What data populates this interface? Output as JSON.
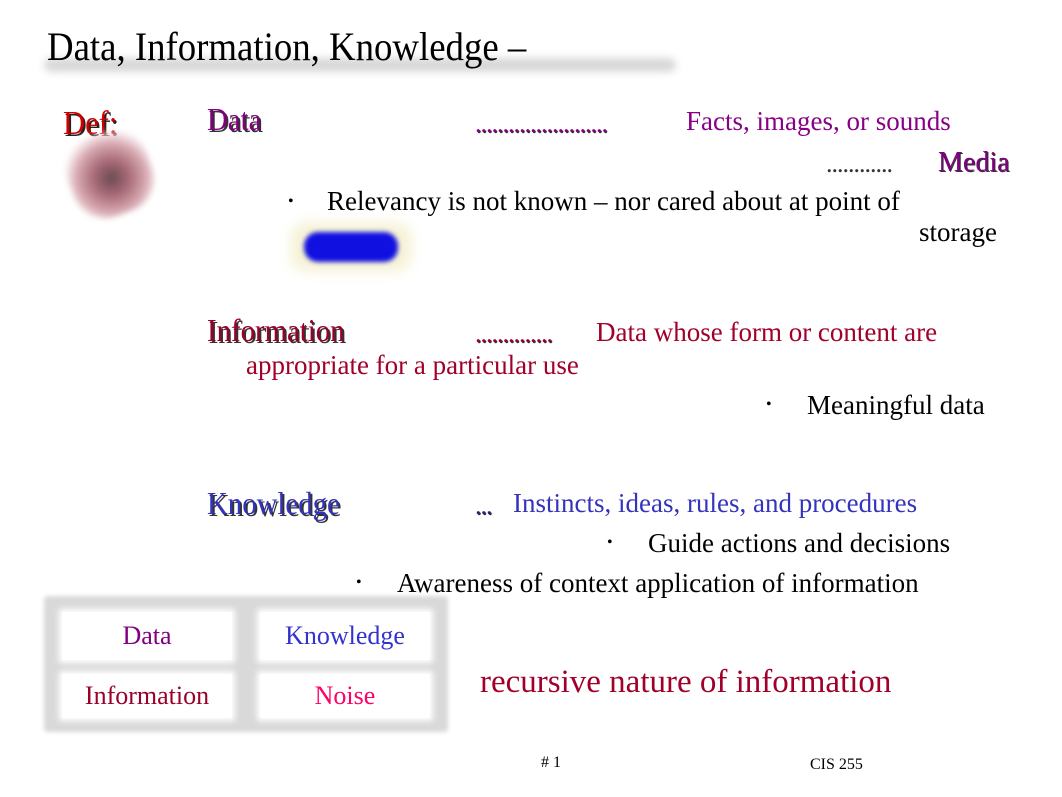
{
  "slide": {
    "title": "Data, Information, Knowledge –",
    "def_label": "Def:",
    "clip_art": "lips-clipart-icon",
    "decorative_shape": "blue-pill-shape",
    "colors": {
      "data": "#800080",
      "information": "#99002a",
      "knowledge": "#3333bb",
      "noise": "#ff0066",
      "def_label": "#cc0000"
    },
    "definitions": {
      "data": {
        "term": "Data",
        "leader": "........................",
        "definition": "Facts, images, or sounds",
        "media_leader": "............",
        "media": "Media",
        "bullets": [
          "Relevancy is not known – nor cared about at point of",
          "storage"
        ]
      },
      "information": {
        "term": "Information",
        "leader": "..............",
        "definition_line1": "Data whose form or content are",
        "definition_line2": "appropriate for a particular use",
        "bullets": [
          "Meaningful data"
        ]
      },
      "knowledge": {
        "term": "Knowledge",
        "leader": "...",
        "definition": "Instincts, ideas, rules, and procedures",
        "bullets": [
          "Guide actions and decisions",
          "Awareness of context application of information"
        ]
      }
    },
    "bullet_glyph": "•",
    "grid": {
      "cells": [
        {
          "label": "Data"
        },
        {
          "label": "Knowledge"
        },
        {
          "label": "Information"
        },
        {
          "label": "Noise"
        }
      ]
    },
    "caption": "recursive nature of information",
    "footer": {
      "page_number": "# 1",
      "course": "CIS 255"
    }
  }
}
